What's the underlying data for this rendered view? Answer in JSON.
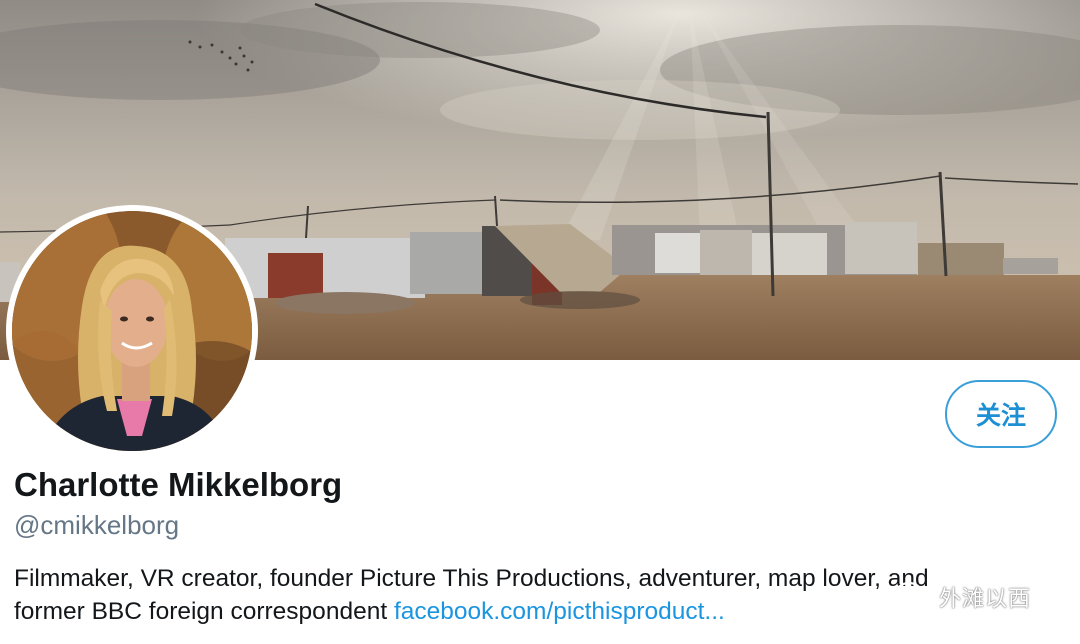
{
  "profile": {
    "display_name": "Charlotte Mikkelborg",
    "handle": "@cmikkelborg",
    "bio_line1": "Filmmaker, VR creator, founder Picture This Productions, adventurer, map lover, and",
    "bio_line2": "former BBC foreign correspondent ",
    "bio_link": "facebook.com/picthisproduct..."
  },
  "actions": {
    "follow_label": "关注"
  },
  "watermark": {
    "text": "外滩以西",
    "icon": "wechat-icon"
  },
  "colors": {
    "accent": "#1b95e0",
    "name_text": "#14171a",
    "handle_text": "#657786"
  }
}
